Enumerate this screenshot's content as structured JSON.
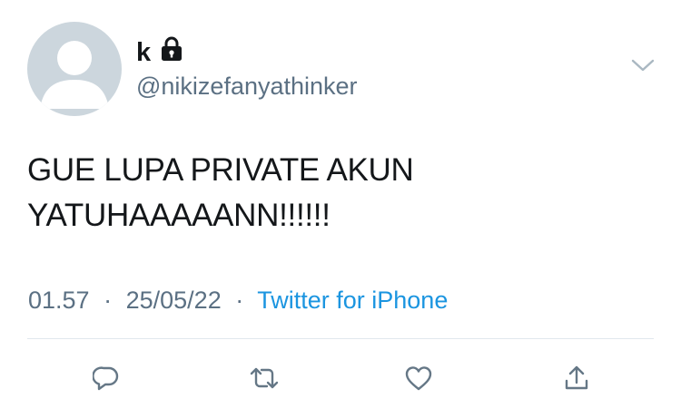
{
  "author": {
    "display_name": "k",
    "handle": "@nikizefanyathinker",
    "avatar_icon": "default-avatar-icon",
    "protected_icon": "lock-icon"
  },
  "tweet": {
    "text_lines": [
      "GUE LUPA PRIVATE AKUN",
      "YATUHAAAAANN!!!!!!"
    ],
    "time": "01.57",
    "separator": "·",
    "date": "25/05/22",
    "source": "Twitter for iPhone"
  },
  "actions": {
    "reply_icon": "reply-icon",
    "retweet_icon": "retweet-icon",
    "like_icon": "heart-icon",
    "share_icon": "share-icon"
  },
  "colors": {
    "text": "#14171a",
    "secondary": "#5b7083",
    "link": "#1b95e0",
    "avatar_bg": "#ccd6dd",
    "icon": "#657786"
  }
}
